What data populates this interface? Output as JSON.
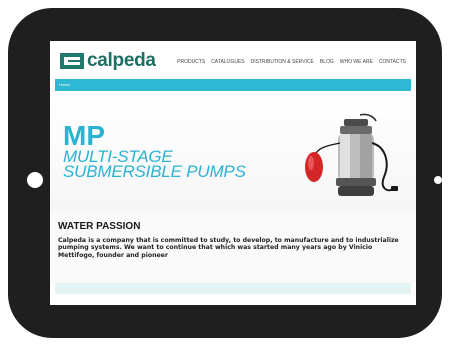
{
  "brand": {
    "name": "calpeda"
  },
  "nav": {
    "items": [
      {
        "label": "PRODUCTS"
      },
      {
        "label": "CATALOGUES"
      },
      {
        "label": "DISTRIBUTION & SERVICE"
      },
      {
        "label": "BLOG"
      },
      {
        "label": "WHO WE ARE"
      },
      {
        "label": "CONTACTS"
      }
    ]
  },
  "breadcrumb": {
    "home": "Home"
  },
  "hero": {
    "title": "MP",
    "subtitle_line1": "MULTI-STAGE",
    "subtitle_line2": "SUBMERSIBLE PUMPS"
  },
  "about": {
    "heading": "WATER PASSION",
    "text": "Calpeda is a company that is committed to study, to develop, to manufacture and to industrialize pumping systems. We want to continue that which was started many years ago by Vinicio Mettifogo, founder and pioneer"
  },
  "colors": {
    "accent": "#2fb8d4",
    "brand": "#1f6f64",
    "device_frame": "#1f1f1f"
  }
}
